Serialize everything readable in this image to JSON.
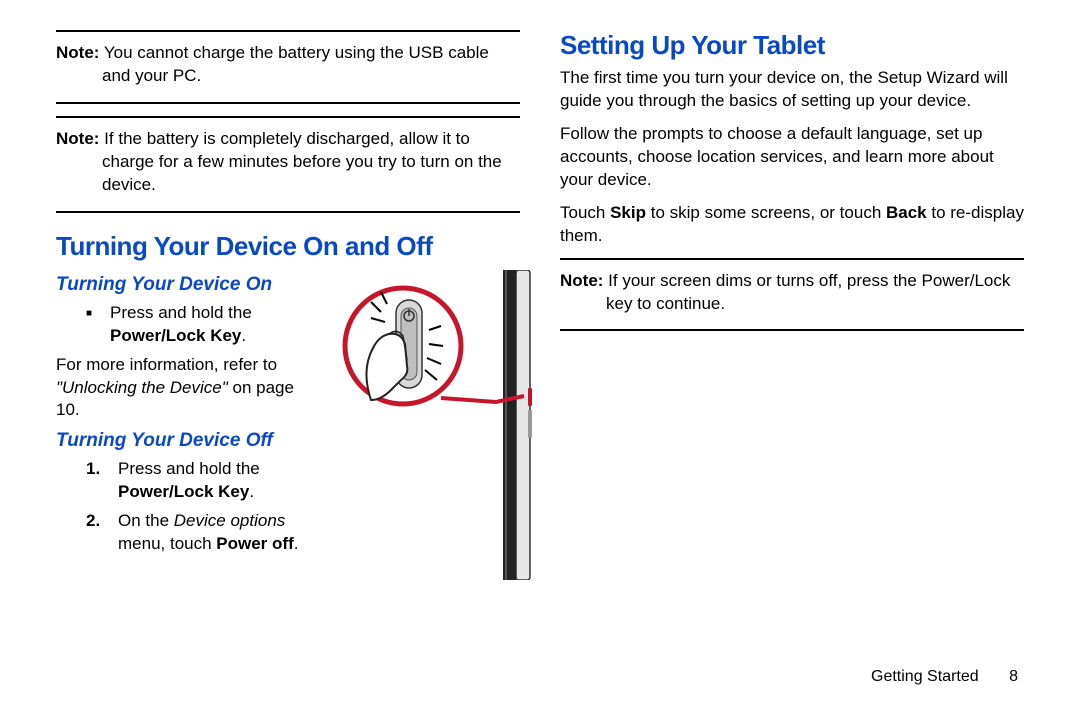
{
  "left": {
    "note1_label": "Note:",
    "note1_text": " You cannot charge the battery using the USB cable and your PC.",
    "note2_label": "Note:",
    "note2_text": " If the battery is completely discharged, allow it to charge for a few minutes before you try to turn on the device.",
    "h2": "Turning Your Device On and Off",
    "h3a": "Turning Your Device On",
    "bullet1a": "Press and hold the ",
    "bullet1b": "Power/Lock Key",
    "bullet1c": ".",
    "info1": "For more information, refer to ",
    "info1i": "\"Unlocking the Device\"",
    "info1b": " on page 10.",
    "h3b": "Turning Your Device Off",
    "step1a": "Press and hold the ",
    "step1b": "Power/Lock Key",
    "step1c": ".",
    "step1n": "1.",
    "step2n": "2.",
    "step2a": "On the ",
    "step2i": "Device options",
    "step2b": " menu, touch ",
    "step2s": "Power off",
    "step2c": "."
  },
  "right": {
    "h2": "Setting Up Your Tablet",
    "p1": "The first time you turn your device on, the Setup Wizard will guide you through the basics of setting up your device.",
    "p2": "Follow the prompts to choose a default language, set up accounts, choose location services, and learn more about your device.",
    "p3a": "Touch ",
    "p3s1": "Skip",
    "p3b": " to skip some screens, or touch ",
    "p3s2": "Back",
    "p3c": " to re-display them.",
    "note_label": "Note:",
    "note_text": " If your screen dims or turns off, press the Power/Lock key to continue."
  },
  "footer": {
    "section": "Getting Started",
    "page": "8"
  }
}
